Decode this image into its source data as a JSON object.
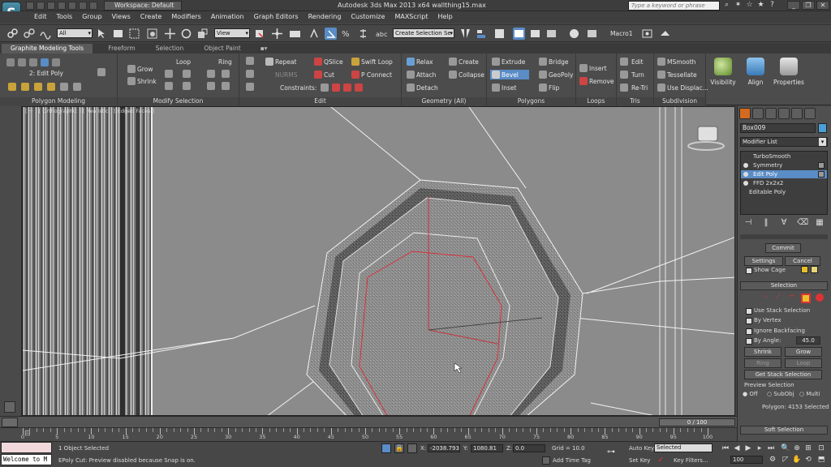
{
  "app": {
    "logo": "S",
    "workspace": "Workspace: Default",
    "title": "Autodesk 3ds Max  2013 x64      wallthing15.max",
    "search_placeholder": "Type a keyword or phrase"
  },
  "menu": [
    "Edit",
    "Tools",
    "Group",
    "Views",
    "Create",
    "Modifiers",
    "Animation",
    "Graph Editors",
    "Rendering",
    "Customize",
    "MAXScript",
    "Help"
  ],
  "toolbar": {
    "filter": "All",
    "ref_coord": "View",
    "selection_set": "Create Selection Se",
    "macro": "Macro1"
  },
  "ribbon_tabs": [
    "Graphite Modeling Tools",
    "Freeform",
    "Selection",
    "Object Paint"
  ],
  "ribbon": {
    "polygon_modeling": {
      "label": "Polygon Modeling",
      "stack": "2: Edit Poly"
    },
    "modify_selection": {
      "label": "Modify Selection",
      "grow": "Grow",
      "shrink": "Shrink",
      "loop": "Loop",
      "ring": "Ring"
    },
    "edit": {
      "label": "Edit",
      "repeat": "Repeat",
      "qslice": "QSlice",
      "swift_loop": "Swift Loop",
      "normal": "NURMS",
      "cut": "Cut",
      "pconnect": "P Connect",
      "constraints": "Constraints:"
    },
    "geometry": {
      "label": "Geometry (All)",
      "relax": "Relax",
      "create": "Create",
      "attach": "Attach",
      "collapse": "Collapse",
      "detach": "Detach"
    },
    "polygons": {
      "label": "Polygons",
      "extrude": "Extrude",
      "bridge": "Bridge",
      "bevel": "Bevel",
      "geopoly": "GeoPoly",
      "inset": "Inset",
      "flip": "Flip"
    },
    "loops": {
      "label": "Loops",
      "insert": "Insert",
      "remove": "Remove"
    },
    "tris": {
      "label": "Tris",
      "edit": "Edit",
      "turn": "Turn",
      "retri": "Re-Tri"
    },
    "subdivision": {
      "label": "Subdivision",
      "msmooth": "MSmooth",
      "tessellate": "Tessellate",
      "use_displace": "Use Displac..."
    },
    "visibility": "Visibility",
    "align": "Align",
    "properties": "Properties"
  },
  "viewport": {
    "label": "[ + ] [ Orthographic ] [ Realistic ] [ Edged Faces ]"
  },
  "command_panel": {
    "object_name": "Box009",
    "modifier_list": "Modifier List",
    "stack": [
      "TurboSmooth",
      "Symmetry",
      "Edit Poly",
      "FFD 2x2x2",
      "Editable Poly"
    ],
    "stack_selected": "Edit Poly",
    "commit": "Commit",
    "settings": "Settings",
    "cancel": "Cancel",
    "show_cage": "Show Cage",
    "selection_header": "Selection",
    "use_stack_selection": "Use Stack Selection",
    "by_vertex": "By Vertex",
    "ignore_backfacing": "Ignore Backfacing",
    "by_angle": "By Angle:",
    "by_angle_value": "45.0",
    "shrink": "Shrink",
    "grow": "Grow",
    "ring": "Ring",
    "loop": "Loop",
    "get_stack_selection": "Get Stack Selection",
    "preview_selection": "Preview Selection",
    "off": "Off",
    "subobj": "SubObj",
    "multi": "Multi",
    "polygon_count": "Polygon: 4153 Selected",
    "soft_selection": "Soft Selection"
  },
  "timeline": {
    "frame": "0 / 100",
    "ticks": [
      0,
      5,
      10,
      15,
      20,
      25,
      30,
      35,
      40,
      45,
      50,
      55,
      60,
      65,
      70,
      75,
      80,
      85,
      90,
      95,
      100
    ]
  },
  "status": {
    "maxscript_text": "Welcome to M",
    "objects_selected": "1 Object Selected",
    "prompt": "EPoly Cut: Preview disabled because Snap is on.",
    "x_label": "X:",
    "x_value": "-2038.793",
    "y_label": "Y:",
    "y_value": "1080.81",
    "z_label": "Z:",
    "z_value": "0.0",
    "grid": "Grid = 10.0",
    "add_time_tag": "Add Time Tag",
    "auto_key": "Auto Key",
    "set_key": "Set Key",
    "selected": "Selected",
    "key_filters": "Key Filters...",
    "current_frame": "100"
  },
  "colors": {
    "accent_blue": "#5a8cc6",
    "selection_red": "#d8323c",
    "viewport_bg": "#8a8a8a"
  }
}
